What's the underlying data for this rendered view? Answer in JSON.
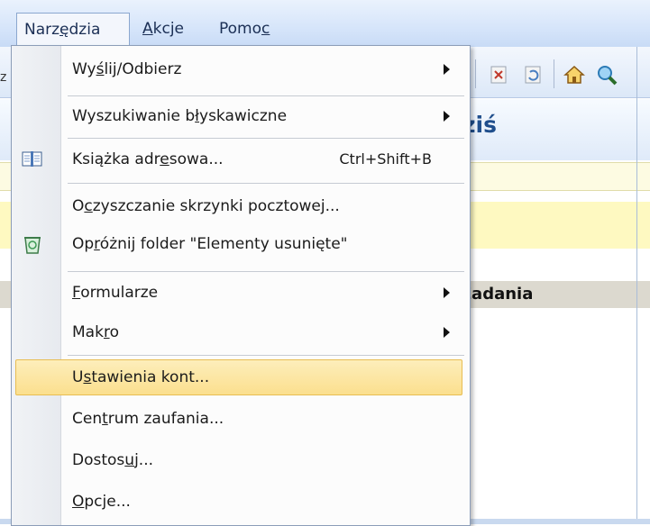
{
  "menubar": {
    "items": [
      {
        "label_pre": "Narz",
        "label_u": "ę",
        "label_post": "dzia"
      },
      {
        "label_pre": "",
        "label_u": "A",
        "label_post": "kcje"
      },
      {
        "label_pre": "Pomo",
        "label_u": "c",
        "label_post": ""
      }
    ]
  },
  "background": {
    "title_fragment": "ziś",
    "tasks_fragment": "Zadania",
    "toolbar_clip": "z",
    "icons": [
      "delete-icon",
      "refresh-icon",
      "home-icon",
      "search-icon"
    ]
  },
  "menu": {
    "items": [
      {
        "pre": "Wy",
        "u": "ś",
        "post": "lij/Odbierz",
        "shortcut": "",
        "submenu": true
      },
      {
        "pre": "Wyszukiwanie b",
        "u": "ł",
        "post": "yskawiczne",
        "shortcut": "",
        "submenu": true
      },
      {
        "pre": "Książka adr",
        "u": "e",
        "post": "sowa...",
        "shortcut": "Ctrl+Shift+B",
        "submenu": false,
        "icon": "address-book-icon"
      },
      {
        "pre": "O",
        "u": "c",
        "post": "zyszczanie skrzynki pocztowej...",
        "shortcut": "",
        "submenu": false
      },
      {
        "pre": "Op",
        "u": "r",
        "post": "óżnij folder \"Elementy usunięte\"",
        "shortcut": "",
        "submenu": false,
        "icon": "recycle-bin-icon"
      },
      {
        "pre": "",
        "u": "F",
        "post": "ormularze",
        "shortcut": "",
        "submenu": true
      },
      {
        "pre": "Mak",
        "u": "r",
        "post": "o",
        "shortcut": "",
        "submenu": true
      },
      {
        "pre": "U",
        "u": "s",
        "post": "tawienia kont...",
        "shortcut": "",
        "submenu": false,
        "highlighted": true
      },
      {
        "pre": "Cen",
        "u": "t",
        "post": "rum zaufania...",
        "shortcut": "",
        "submenu": false
      },
      {
        "pre": "Dostos",
        "u": "u",
        "post": "j...",
        "shortcut": "",
        "submenu": false
      },
      {
        "pre": "",
        "u": "O",
        "post": "pcje...",
        "shortcut": "",
        "submenu": false
      }
    ]
  },
  "colors": {
    "highlight": "#fbdf8e",
    "menubar": "#d6e5fa",
    "header_title": "#1f4e8c"
  }
}
